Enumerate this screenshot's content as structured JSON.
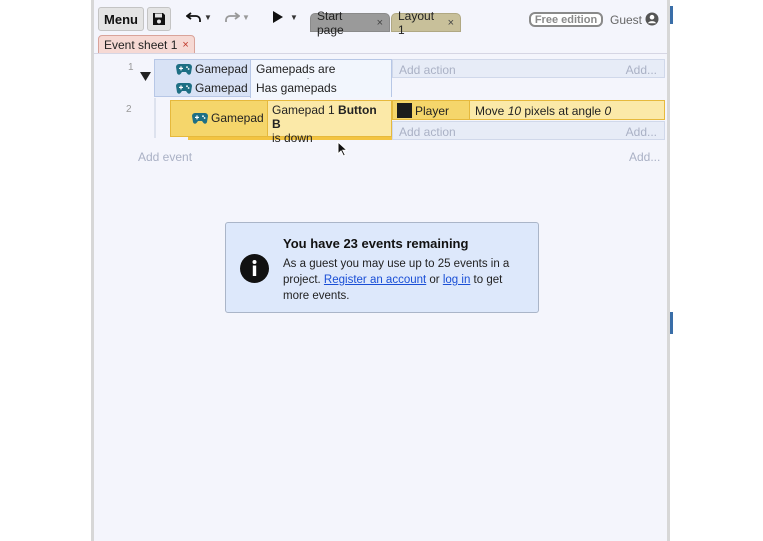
{
  "toolbar": {
    "menu_label": "Menu",
    "save_icon": "floppy-disk-icon",
    "undo_icon": "undo-icon",
    "redo_icon": "redo-icon",
    "play_icon": "play-icon",
    "tabs": [
      {
        "label": "Start page",
        "close": "×"
      },
      {
        "label": "Layout 1",
        "close": "×"
      }
    ],
    "free_edition_label": "Free edition",
    "guest_label": "Guest",
    "user_icon": "user-circle-icon"
  },
  "sheet_tab": {
    "label": "Event sheet 1",
    "close": "×"
  },
  "events": [
    {
      "number": "1",
      "conditions": [
        {
          "object": "Gamepad",
          "text": "Gamepads are supported"
        },
        {
          "object": "Gamepad",
          "text": "Has gamepads"
        }
      ],
      "add_action": "Add action",
      "add_more": "Add..."
    },
    {
      "number": "2",
      "condition_object": "Gamepad",
      "condition_text_pre": "Gamepad 1 ",
      "condition_text_bold": "Button B",
      "condition_text_post": "is down",
      "action_object": "Player",
      "action_text_pre": "Move ",
      "action_text_value1": "10",
      "action_text_mid": " pixels at angle ",
      "action_text_value2": "0",
      "add_action": "Add action",
      "add_more": "Add..."
    }
  ],
  "add_event": "Add event",
  "add_event_more": "Add...",
  "info": {
    "title": "You have 23 events remaining",
    "body_pre": "As a guest you may use up to 25 events in a project. ",
    "register_link": "Register an account",
    "or": " or ",
    "login_link": "log in",
    "body_post": " to get more events."
  },
  "colors": {
    "event_highlight": "#f5d66b",
    "condition_block": "#d8e2f5",
    "info_background": "#dde8fb",
    "link": "#1a4fd6"
  }
}
